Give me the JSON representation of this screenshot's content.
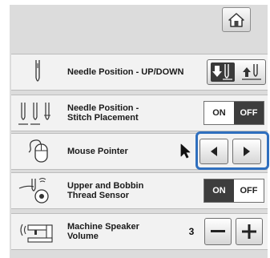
{
  "header": {
    "home_icon": "home-icon"
  },
  "settings": [
    {
      "id": "needle-position-up-down",
      "label": "Needle Position - UP/DOWN",
      "icon": "needle-icon",
      "control": {
        "type": "button",
        "icons": [
          "needle-down-icon",
          "needle-up-icon"
        ]
      }
    },
    {
      "id": "needle-position-stitch-placement",
      "label_line1": "Needle Position -",
      "label_line2": "Stitch Placement",
      "icon": "triple-needle-icon",
      "control": {
        "type": "toggle",
        "on_label": "ON",
        "off_label": "OFF",
        "selected": "OFF"
      }
    },
    {
      "id": "mouse-pointer",
      "label": "Mouse Pointer",
      "icon": "mouse-icon",
      "pointer_icon": "arrow-cursor-icon",
      "control": {
        "type": "arrows",
        "left_icon": "arrow-left-icon",
        "right_icon": "arrow-right-icon"
      }
    },
    {
      "id": "upper-bobbin-thread-sensor",
      "label_line1": "Upper and Bobbin",
      "label_line2": "Thread Sensor",
      "icon": "thread-sensor-icon",
      "control": {
        "type": "toggle",
        "on_label": "ON",
        "off_label": "OFF",
        "selected": "ON"
      }
    },
    {
      "id": "machine-speaker-volume",
      "label_line1": "Machine Speaker",
      "label_line2": "Volume",
      "icon": "speaker-machine-icon",
      "control": {
        "type": "stepper",
        "value": "3",
        "minus_icon": "minus-icon",
        "plus_icon": "plus-icon"
      }
    }
  ],
  "colors": {
    "highlight": "#2f6fbe",
    "selected_toggle": "#3d3d3d"
  }
}
